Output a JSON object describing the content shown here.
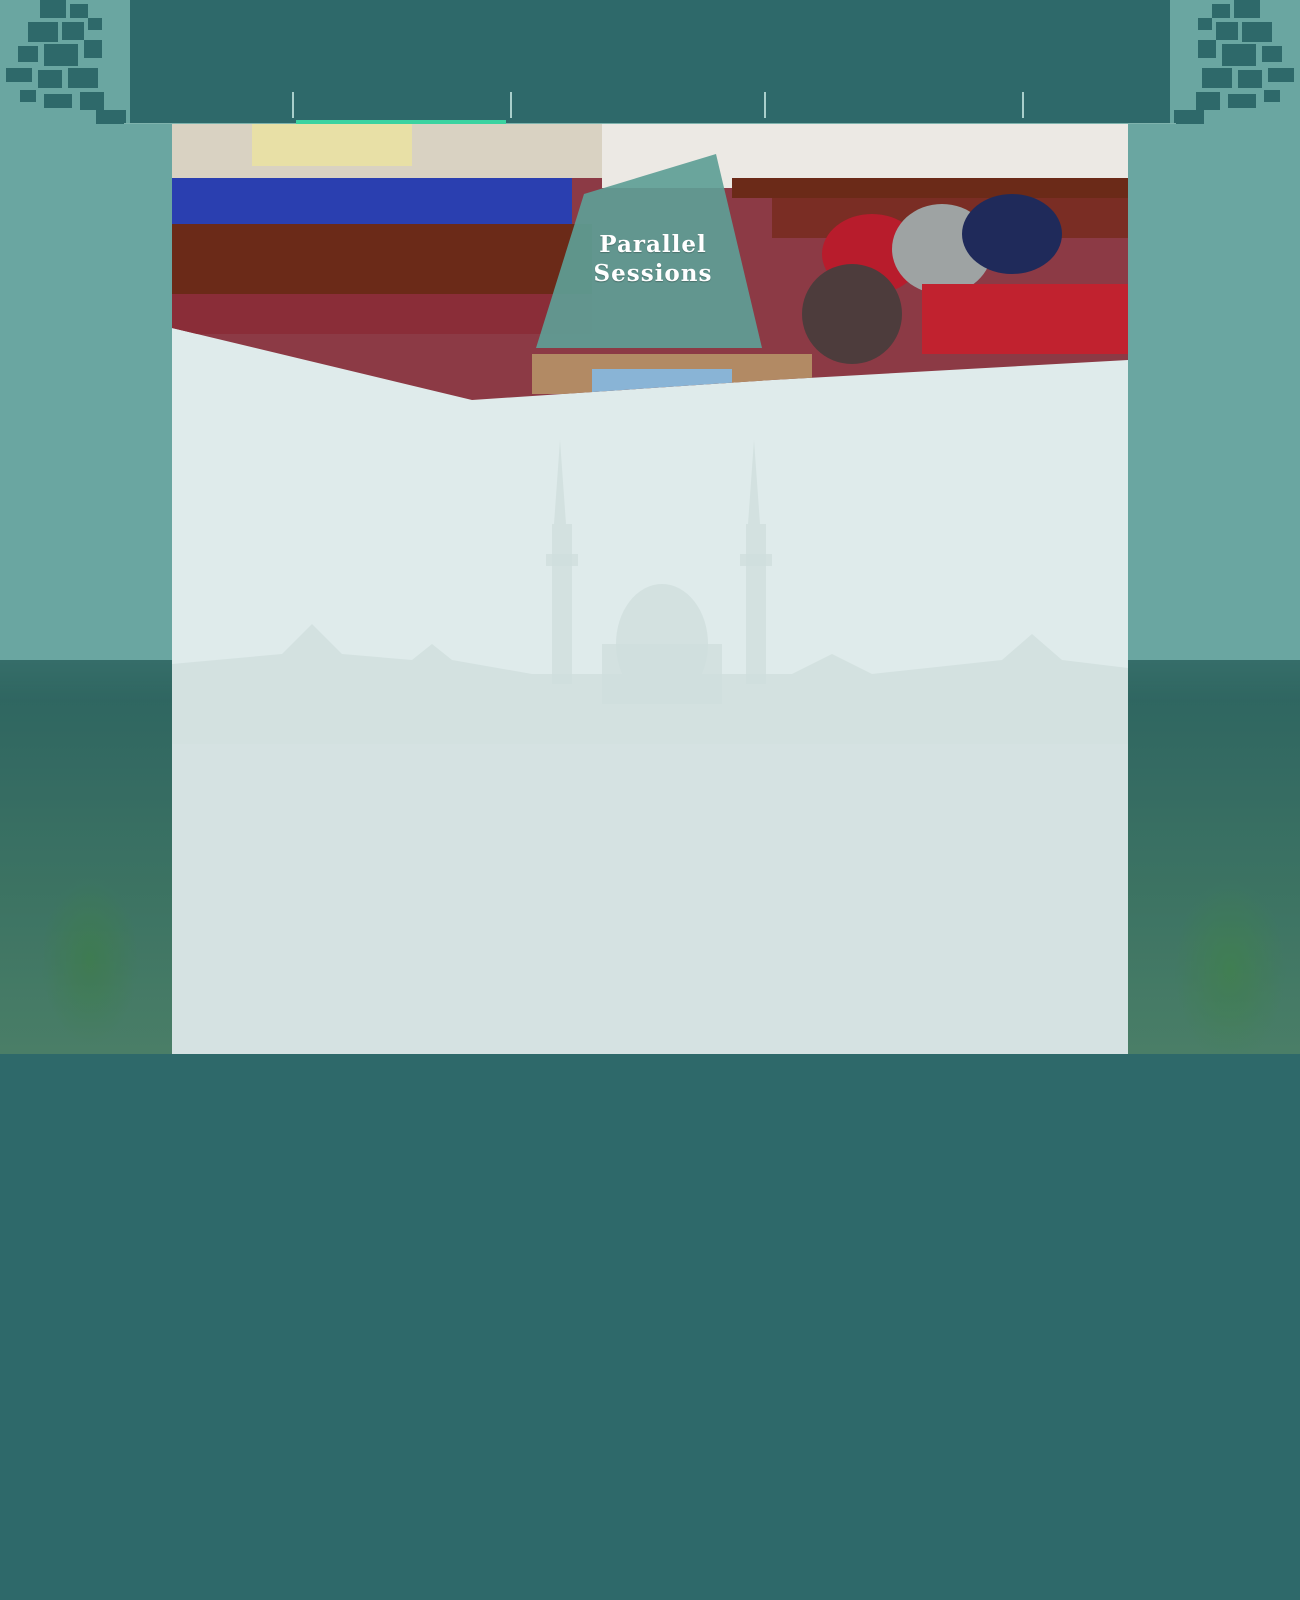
{
  "nav": {
    "items": [
      {
        "label": "",
        "active": false
      },
      {
        "label": "",
        "active": true
      },
      {
        "label": "",
        "active": false
      },
      {
        "label": "",
        "active": false
      }
    ]
  },
  "hero": {
    "title_line1": "Parallel",
    "title_line2": "Sessions",
    "image": "conference-room-photo"
  },
  "colors": {
    "background": "#2e696a",
    "backdrop": "#6aa6a1",
    "content_panel": "#dfebeb",
    "title_panel": "#5e9e96",
    "active_indicator": "#3bd3a0"
  },
  "icons": {
    "corner_left": "pixel-pattern-icon",
    "corner_right": "pixel-pattern-icon",
    "watermark": "mosque-silhouette"
  }
}
